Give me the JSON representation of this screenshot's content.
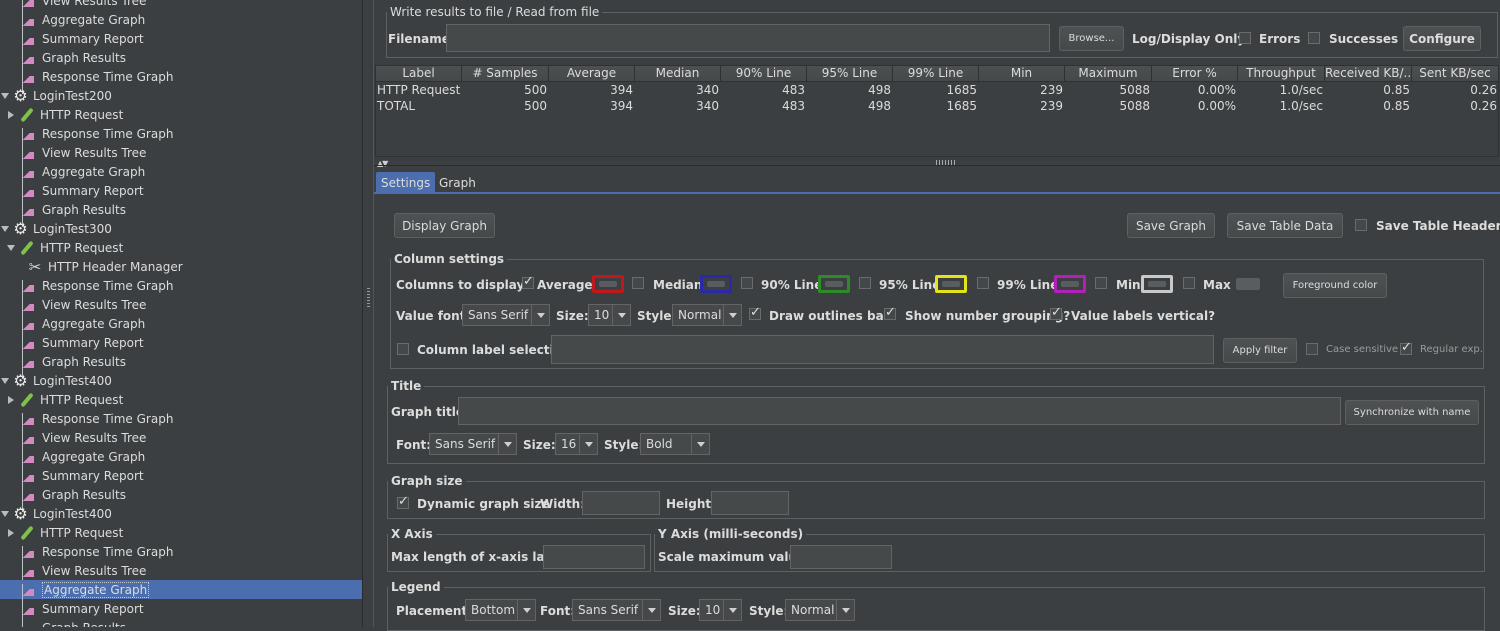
{
  "tree": [
    {
      "label": "View Results Tree",
      "kind": "graph",
      "indent": 1
    },
    {
      "label": "Aggregate Graph",
      "kind": "graph",
      "indent": 1
    },
    {
      "label": "Summary Report",
      "kind": "graph",
      "indent": 1
    },
    {
      "label": "Graph Results",
      "kind": "graph",
      "indent": 1
    },
    {
      "label": "Response Time Graph",
      "kind": "graph",
      "indent": 1
    },
    {
      "label": "LoginTest200",
      "kind": "group",
      "indent": 0
    },
    {
      "label": "HTTP Request",
      "kind": "sampler",
      "indent": 1
    },
    {
      "label": "Response Time Graph",
      "kind": "graph",
      "indent": 1
    },
    {
      "label": "View Results Tree",
      "kind": "graph",
      "indent": 1
    },
    {
      "label": "Aggregate Graph",
      "kind": "graph",
      "indent": 1
    },
    {
      "label": "Summary Report",
      "kind": "graph",
      "indent": 1
    },
    {
      "label": "Graph Results",
      "kind": "graph",
      "indent": 1
    },
    {
      "label": "LoginTest300",
      "kind": "group",
      "indent": 0
    },
    {
      "label": "HTTP Request",
      "kind": "sampler-open",
      "indent": 1
    },
    {
      "label": "HTTP Header Manager",
      "kind": "tools",
      "indent": 2
    },
    {
      "label": "Response Time Graph",
      "kind": "graph",
      "indent": 1
    },
    {
      "label": "View Results Tree",
      "kind": "graph",
      "indent": 1
    },
    {
      "label": "Aggregate Graph",
      "kind": "graph",
      "indent": 1
    },
    {
      "label": "Summary Report",
      "kind": "graph",
      "indent": 1
    },
    {
      "label": "Graph Results",
      "kind": "graph",
      "indent": 1
    },
    {
      "label": "LoginTest400",
      "kind": "group",
      "indent": 0
    },
    {
      "label": "HTTP Request",
      "kind": "sampler",
      "indent": 1
    },
    {
      "label": "Response Time Graph",
      "kind": "graph",
      "indent": 1
    },
    {
      "label": "View Results Tree",
      "kind": "graph",
      "indent": 1
    },
    {
      "label": "Aggregate Graph",
      "kind": "graph",
      "indent": 1
    },
    {
      "label": "Summary Report",
      "kind": "graph",
      "indent": 1
    },
    {
      "label": "Graph Results",
      "kind": "graph",
      "indent": 1
    },
    {
      "label": "LoginTest400",
      "kind": "group",
      "indent": 0
    },
    {
      "label": "HTTP Request",
      "kind": "sampler",
      "indent": 1
    },
    {
      "label": "Response Time Graph",
      "kind": "graph",
      "indent": 1
    },
    {
      "label": "View Results Tree",
      "kind": "graph",
      "indent": 1
    },
    {
      "label": "Aggregate Graph",
      "kind": "graph",
      "indent": 1,
      "selected": true
    },
    {
      "label": "Summary Report",
      "kind": "graph",
      "indent": 1
    },
    {
      "label": "Graph Results",
      "kind": "graph",
      "indent": 1
    }
  ],
  "write_results": {
    "legend": "Write results to file / Read from file",
    "filename_label": "Filename",
    "filename_value": "",
    "browse": "Browse...",
    "log_display_only": "Log/Display Only:",
    "errors": "Errors",
    "successes": "Successes",
    "configure": "Configure"
  },
  "table": {
    "headers": [
      "Label",
      "# Samples",
      "Average",
      "Median",
      "90% Line",
      "95% Line",
      "99% Line",
      "Min",
      "Maximum",
      "Error %",
      "Throughput",
      "Received KB/...",
      "Sent KB/sec"
    ],
    "rows": [
      [
        "HTTP Request",
        "500",
        "394",
        "340",
        "483",
        "498",
        "1685",
        "239",
        "5088",
        "0.00%",
        "1.0/sec",
        "0.85",
        "0.26"
      ],
      [
        "TOTAL",
        "500",
        "394",
        "340",
        "483",
        "498",
        "1685",
        "239",
        "5088",
        "0.00%",
        "1.0/sec",
        "0.85",
        "0.26"
      ]
    ]
  },
  "tabs": {
    "settings": "Settings",
    "graph": "Graph"
  },
  "actions": {
    "display_graph": "Display Graph",
    "save_graph": "Save Graph",
    "save_table_data": "Save Table Data",
    "save_table_header": "Save Table Header"
  },
  "column_settings": {
    "legend": "Column settings",
    "columns_to_display": "Columns to display:",
    "columns": [
      {
        "label": "Average",
        "checked": true,
        "color": "#c0181b"
      },
      {
        "label": "Median",
        "checked": false,
        "color": "#2a2aa8"
      },
      {
        "label": "90% Line",
        "checked": false,
        "color": "#2f8a2a"
      },
      {
        "label": "95% Line",
        "checked": false,
        "color": "#e6e21a"
      },
      {
        "label": "99% Line",
        "checked": false,
        "color": "#b41eb9"
      },
      {
        "label": "Min",
        "checked": false,
        "color": "#c9c9c9"
      },
      {
        "label": "Max",
        "checked": false,
        "color": "#5a5d60"
      }
    ],
    "foreground_color": "Foreground color",
    "value_font": "Value font:",
    "font_value": "Sans Serif",
    "size_label": "Size:",
    "size_value": "10",
    "style_label": "Style:",
    "style_value": "Normal",
    "draw_outlines": "Draw outlines bar?",
    "show_grouping": "Show number grouping?",
    "labels_vertical": "Value labels vertical?",
    "column_label_selection": "Column label selection:",
    "apply_filter": "Apply filter",
    "case_sensitive": "Case sensitive",
    "regular_exp": "Regular exp."
  },
  "title_section": {
    "legend": "Title",
    "graph_title": "Graph title:",
    "sync": "Synchronize with name",
    "font_label": "Font:",
    "font_value": "Sans Serif",
    "size_label": "Size:",
    "size_value": "16",
    "style_label": "Style:",
    "style_value": "Bold"
  },
  "graph_size": {
    "legend": "Graph size",
    "dynamic": "Dynamic graph size",
    "width": "Width:",
    "height": "Height:"
  },
  "x_axis": {
    "legend": "X Axis",
    "max_len": "Max length of x-axis label:"
  },
  "y_axis": {
    "legend": "Y Axis (milli-seconds)",
    "scale_max": "Scale maximum value:"
  },
  "legend_section": {
    "legend": "Legend",
    "placement": "Placement:",
    "placement_value": "Bottom",
    "font_label": "Font:",
    "font_value": "Sans Serif",
    "size_label": "Size:",
    "size_value": "10",
    "style_label": "Style:",
    "style_value": "Normal"
  }
}
